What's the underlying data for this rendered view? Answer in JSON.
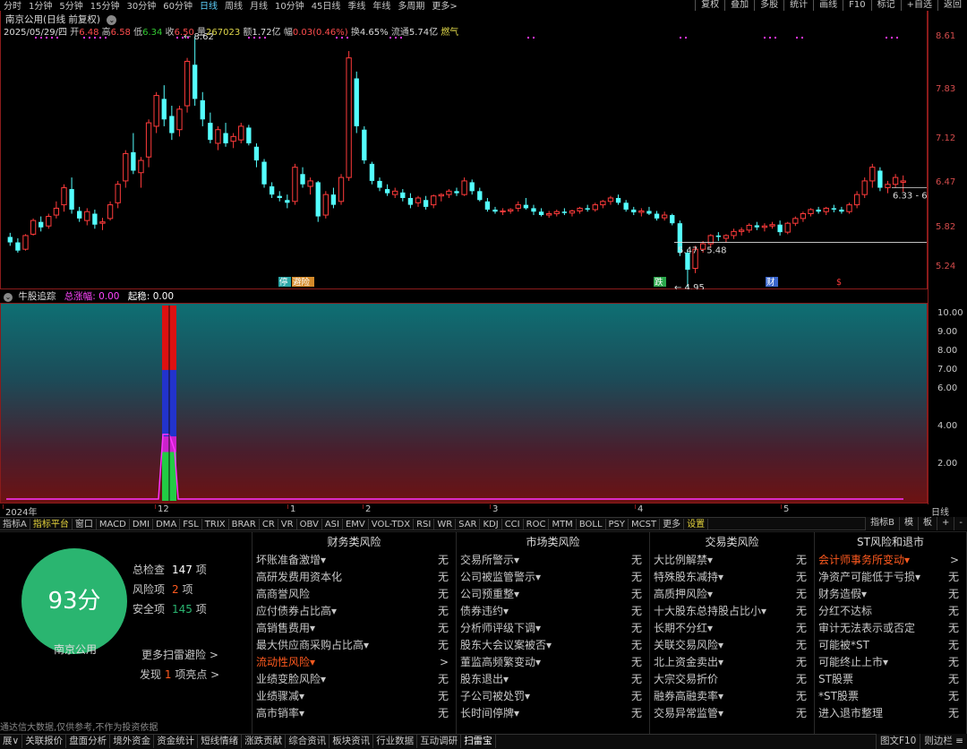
{
  "periods": [
    "分时",
    "1分钟",
    "5分钟",
    "15分钟",
    "30分钟",
    "60分钟",
    "日线",
    "周线",
    "月线",
    "10分钟",
    "45日线",
    "季线",
    "年线",
    "多周期",
    "更多>"
  ],
  "active_period": "日线",
  "toolbar_right": [
    "复权",
    "叠加",
    "多股",
    "统计",
    "画线",
    "F10",
    "标记",
    "+自选",
    "返回"
  ],
  "stock_title": "南京公用(日线 前复权)",
  "quote": {
    "date": "2025/05/29/四",
    "open_label": "开",
    "open": "6.48",
    "high_label": "高",
    "high": "6.58",
    "low_label": "低",
    "low": "6.34",
    "close_label": "收",
    "close": "6.50",
    "vol_label": "量",
    "volume": "267023",
    "amt_label": "额",
    "amount": "1.72亿",
    "chg_label": "幅",
    "change": "0.03(0.46%)",
    "turn_label": "换",
    "turnover": "4.65%",
    "float_label": "流通",
    "float_cap": "5.74亿",
    "concept": "燃气"
  },
  "price_axis": [
    "8.61",
    "7.83",
    "7.12",
    "6.47",
    "5.82",
    "5.24"
  ],
  "chart_annotations": {
    "high": "8.62",
    "low": "4.95",
    "range_low": "5.47 - 5.48",
    "range_right": "6.33 - 6."
  },
  "event_tags": [
    "停",
    "避险",
    "跌",
    "财",
    "$"
  ],
  "sub_indicator": {
    "name": "牛股追踪",
    "field1_label": "总涨幅",
    "field1_value": "0.00",
    "field2_label": "起稳",
    "field2_value": "0.00"
  },
  "sub_axis": [
    "10.00",
    "9.00",
    "8.00",
    "7.00",
    "6.00",
    "4.00",
    "2.00"
  ],
  "date_axis": [
    "2024年",
    "12",
    "1",
    "2",
    "3",
    "4",
    "5"
  ],
  "date_axis_right": "日线",
  "indicator_tabs": [
    "指标A",
    "指标平台",
    "窗口",
    "MACD",
    "DMI",
    "DMA",
    "FSL",
    "TRIX",
    "BRAR",
    "CR",
    "VR",
    "OBV",
    "ASI",
    "EMV",
    "VOL-TDX",
    "RSI",
    "WR",
    "SAR",
    "KDJ",
    "CCI",
    "ROC",
    "MTM",
    "BOLL",
    "PSY",
    "MCST",
    "更多",
    "设置"
  ],
  "indicator_tabs_right": [
    "指标B",
    "模",
    "板",
    "+",
    "-"
  ],
  "risk": {
    "score": "93分",
    "stock_name": "南京公用",
    "total_label": "总检查",
    "total": "147",
    "total_unit": "项",
    "risk_label": "风险项",
    "risk": "2",
    "risk_unit": "项",
    "safe_label": "安全项",
    "safe": "145",
    "safe_unit": "项",
    "more": "更多扫雷避险 >",
    "found_prefix": "发现",
    "found_count": "1",
    "found_suffix": "项亮点 >",
    "watermark": "通达信大数据,仅供参考,不作为投资依据",
    "colors": {
      "score_bg": "#2ab570",
      "highlight": "#ff5a1f"
    }
  },
  "risk_columns": [
    {
      "title": "财务类风险",
      "items": [
        {
          "name": "坏账准备激增▾",
          "status": "无"
        },
        {
          "name": "高研发费用资本化",
          "status": "无"
        },
        {
          "name": "高商誉风险",
          "status": "无"
        },
        {
          "name": "应付债券占比高▾",
          "status": "无"
        },
        {
          "name": "高销售费用▾",
          "status": "无"
        },
        {
          "name": "最大供应商采购占比高▾",
          "status": "无"
        },
        {
          "name": "流动性风险▾",
          "status": ">",
          "hl": true
        },
        {
          "name": "业绩变脸风险▾",
          "status": "无"
        },
        {
          "name": "业绩骤减▾",
          "status": "无"
        },
        {
          "name": "高市销率▾",
          "status": "无"
        }
      ]
    },
    {
      "title": "市场类风险",
      "items": [
        {
          "name": "交易所警示▾",
          "status": "无"
        },
        {
          "name": "公司被监管警示▾",
          "status": "无"
        },
        {
          "name": "公司预重整▾",
          "status": "无"
        },
        {
          "name": "债券违约▾",
          "status": "无"
        },
        {
          "name": "分析师评级下调▾",
          "status": "无"
        },
        {
          "name": "股东大会议案被否▾",
          "status": "无"
        },
        {
          "name": "董监高频繁变动▾",
          "status": "无"
        },
        {
          "name": "股东退出▾",
          "status": "无"
        },
        {
          "name": "子公司被处罚▾",
          "status": "无"
        },
        {
          "name": "长时间停牌▾",
          "status": "无"
        }
      ]
    },
    {
      "title": "交易类风险",
      "items": [
        {
          "name": "大比例解禁▾",
          "status": "无"
        },
        {
          "name": "特殊股东减持▾",
          "status": "无"
        },
        {
          "name": "高质押风险▾",
          "status": "无"
        },
        {
          "name": "十大股东总持股占比小▾",
          "status": "无"
        },
        {
          "name": "长期不分红▾",
          "status": "无"
        },
        {
          "name": "关联交易风险▾",
          "status": "无"
        },
        {
          "name": "北上资金卖出▾",
          "status": "无"
        },
        {
          "name": "大宗交易折价",
          "status": "无"
        },
        {
          "name": "融券高融卖率▾",
          "status": "无"
        },
        {
          "name": "交易异常监管▾",
          "status": "无"
        }
      ]
    },
    {
      "title": "ST风险和退市",
      "items": [
        {
          "name": "会计师事务所变动▾",
          "status": ">",
          "hl": true
        },
        {
          "name": "净资产可能低于亏损▾",
          "status": "无"
        },
        {
          "name": "财务造假▾",
          "status": "无"
        },
        {
          "name": "分红不达标",
          "status": "无"
        },
        {
          "name": "审计无法表示或否定",
          "status": "无"
        },
        {
          "name": "可能被*ST",
          "status": "无"
        },
        {
          "name": "可能终止上市▾",
          "status": "无"
        },
        {
          "name": "ST股票",
          "status": "无"
        },
        {
          "name": "*ST股票",
          "status": "无"
        },
        {
          "name": "进入退市整理",
          "status": "无"
        }
      ]
    }
  ],
  "bottom_tabs": [
    "展∨",
    "关联报价",
    "盘面分析",
    "境外资金",
    "资金统计",
    "短线情绪",
    "涨跌贡献",
    "综合资讯",
    "板块资讯",
    "行业数据",
    "互动调研",
    "扫雷宝"
  ],
  "bottom_active": "扫雷宝",
  "bottom_right": [
    "图文F10",
    "则边栏 ≡"
  ],
  "chart_data": {
    "type": "candlestick",
    "y_axis_ticks": [
      8.61,
      7.83,
      7.12,
      6.47,
      5.82,
      5.24
    ],
    "ohlc": [
      [
        5.68,
        5.74,
        5.55,
        5.6
      ],
      [
        5.6,
        5.66,
        5.45,
        5.48
      ],
      [
        5.5,
        5.72,
        5.48,
        5.7
      ],
      [
        5.72,
        5.95,
        5.7,
        5.92
      ],
      [
        5.9,
        5.98,
        5.76,
        5.82
      ],
      [
        5.84,
        6.02,
        5.8,
        5.98
      ],
      [
        6.0,
        6.2,
        5.95,
        6.1
      ],
      [
        6.15,
        6.45,
        6.05,
        6.4
      ],
      [
        6.38,
        6.55,
        6.02,
        6.08
      ],
      [
        6.06,
        6.12,
        5.9,
        5.95
      ],
      [
        5.92,
        6.1,
        5.85,
        6.05
      ],
      [
        6.02,
        6.08,
        5.8,
        5.86
      ],
      [
        5.88,
        5.96,
        5.78,
        5.9
      ],
      [
        5.95,
        6.2,
        5.92,
        6.15
      ],
      [
        6.18,
        6.5,
        6.1,
        6.45
      ],
      [
        6.5,
        6.95,
        6.4,
        6.9
      ],
      [
        6.92,
        7.2,
        6.6,
        6.65
      ],
      [
        6.62,
        6.85,
        6.4,
        6.8
      ],
      [
        6.85,
        7.4,
        6.7,
        7.35
      ],
      [
        7.3,
        7.8,
        7.2,
        7.75
      ],
      [
        7.7,
        7.9,
        7.3,
        7.4
      ],
      [
        7.45,
        7.6,
        7.1,
        7.2
      ],
      [
        7.25,
        7.6,
        7.15,
        7.55
      ],
      [
        7.6,
        8.3,
        7.5,
        8.25
      ],
      [
        8.2,
        8.62,
        7.6,
        7.7
      ],
      [
        7.68,
        7.8,
        7.3,
        7.4
      ],
      [
        7.35,
        7.5,
        7.05,
        7.1
      ],
      [
        7.05,
        7.3,
        6.95,
        7.25
      ],
      [
        7.2,
        7.35,
        7.0,
        7.05
      ],
      [
        7.08,
        7.2,
        6.98,
        7.15
      ],
      [
        7.1,
        7.35,
        7.05,
        7.3
      ],
      [
        7.28,
        7.32,
        7.02,
        7.05
      ],
      [
        7.0,
        7.05,
        6.7,
        6.8
      ],
      [
        6.78,
        6.82,
        6.4,
        6.45
      ],
      [
        6.42,
        6.48,
        6.25,
        6.3
      ],
      [
        6.28,
        6.35,
        6.2,
        6.25
      ],
      [
        6.22,
        6.3,
        6.1,
        6.18
      ],
      [
        6.2,
        6.75,
        6.15,
        6.7
      ],
      [
        6.6,
        6.7,
        6.4,
        6.45
      ],
      [
        6.42,
        6.55,
        6.3,
        6.5
      ],
      [
        6.48,
        6.5,
        5.9,
        5.98
      ],
      [
        6.0,
        6.35,
        5.95,
        6.3
      ],
      [
        6.3,
        6.4,
        6.1,
        6.15
      ],
      [
        6.2,
        6.6,
        6.15,
        6.55
      ],
      [
        6.55,
        8.4,
        6.5,
        8.3
      ],
      [
        8.0,
        8.1,
        7.2,
        7.3
      ],
      [
        7.25,
        7.3,
        6.75,
        6.8
      ],
      [
        6.75,
        6.78,
        6.45,
        6.5
      ],
      [
        6.5,
        6.55,
        6.35,
        6.4
      ],
      [
        6.38,
        6.45,
        6.28,
        6.32
      ],
      [
        6.3,
        6.4,
        6.25,
        6.35
      ],
      [
        6.33,
        6.38,
        6.2,
        6.25
      ],
      [
        6.25,
        6.32,
        6.1,
        6.15
      ],
      [
        6.18,
        6.28,
        6.12,
        6.25
      ],
      [
        6.22,
        6.28,
        6.08,
        6.12
      ],
      [
        6.15,
        6.3,
        6.1,
        6.28
      ],
      [
        6.28,
        6.32,
        6.2,
        6.3
      ],
      [
        6.3,
        6.38,
        6.25,
        6.35
      ],
      [
        6.35,
        6.4,
        6.28,
        6.32
      ],
      [
        6.3,
        6.55,
        6.28,
        6.5
      ],
      [
        6.48,
        6.52,
        6.3,
        6.35
      ],
      [
        6.35,
        6.4,
        6.2,
        6.22
      ],
      [
        6.2,
        6.25,
        6.05,
        6.08
      ],
      [
        6.08,
        6.12,
        6.02,
        6.05
      ],
      [
        6.05,
        6.1,
        6.0,
        6.06
      ],
      [
        6.06,
        6.1,
        6.02,
        6.08
      ],
      [
        6.1,
        6.2,
        6.05,
        6.15
      ],
      [
        6.15,
        6.25,
        6.08,
        6.1
      ],
      [
        6.1,
        6.15,
        6.0,
        6.05
      ],
      [
        6.05,
        6.1,
        5.98,
        6.0
      ],
      [
        6.0,
        6.06,
        5.96,
        6.02
      ],
      [
        6.02,
        6.08,
        5.98,
        6.05
      ],
      [
        6.05,
        6.1,
        6.0,
        6.03
      ],
      [
        6.03,
        6.08,
        5.98,
        6.06
      ],
      [
        6.06,
        6.12,
        6.02,
        6.1
      ],
      [
        6.1,
        6.15,
        6.05,
        6.08
      ],
      [
        6.08,
        6.18,
        6.05,
        6.15
      ],
      [
        6.15,
        6.22,
        6.1,
        6.2
      ],
      [
        6.2,
        6.28,
        6.15,
        6.25
      ],
      [
        6.25,
        6.3,
        6.15,
        6.18
      ],
      [
        6.18,
        6.22,
        6.05,
        6.08
      ],
      [
        6.08,
        6.12,
        6.0,
        6.04
      ],
      [
        6.04,
        6.1,
        5.98,
        6.06
      ],
      [
        6.06,
        6.12,
        6.0,
        6.02
      ],
      [
        6.02,
        6.06,
        5.92,
        5.95
      ],
      [
        5.96,
        6.05,
        5.92,
        6.0
      ],
      [
        6.0,
        6.02,
        5.85,
        5.88
      ],
      [
        5.88,
        5.92,
        5.4,
        5.45
      ],
      [
        5.45,
        5.5,
        4.95,
        5.2
      ],
      [
        5.22,
        5.55,
        5.15,
        5.5
      ],
      [
        5.5,
        5.62,
        5.45,
        5.58
      ],
      [
        5.58,
        5.72,
        5.52,
        5.7
      ],
      [
        5.7,
        5.75,
        5.62,
        5.68
      ],
      [
        5.66,
        5.72,
        5.6,
        5.7
      ],
      [
        5.7,
        5.8,
        5.65,
        5.76
      ],
      [
        5.76,
        5.82,
        5.7,
        5.78
      ],
      [
        5.78,
        5.88,
        5.74,
        5.85
      ],
      [
        5.85,
        5.9,
        5.78,
        5.82
      ],
      [
        5.82,
        5.88,
        5.76,
        5.84
      ],
      [
        5.84,
        5.9,
        5.8,
        5.86
      ],
      [
        5.86,
        5.92,
        5.7,
        5.75
      ],
      [
        5.75,
        5.9,
        5.72,
        5.88
      ],
      [
        5.88,
        5.98,
        5.84,
        5.95
      ],
      [
        5.95,
        6.05,
        5.9,
        6.02
      ],
      [
        6.02,
        6.1,
        5.98,
        6.08
      ],
      [
        6.08,
        6.12,
        6.02,
        6.05
      ],
      [
        6.05,
        6.12,
        6.0,
        6.1
      ],
      [
        6.1,
        6.15,
        6.04,
        6.08
      ],
      [
        6.08,
        6.12,
        6.02,
        6.05
      ],
      [
        6.05,
        6.18,
        6.02,
        6.15
      ],
      [
        6.15,
        6.35,
        6.1,
        6.3
      ],
      [
        6.3,
        6.55,
        6.25,
        6.5
      ],
      [
        6.5,
        6.75,
        6.4,
        6.7
      ],
      [
        6.65,
        6.7,
        6.35,
        6.4
      ],
      [
        6.4,
        6.5,
        6.32,
        6.45
      ],
      [
        6.45,
        6.6,
        6.4,
        6.55
      ],
      [
        6.48,
        6.58,
        6.34,
        6.5
      ]
    ],
    "sub_axis_ticks": [
      10,
      9,
      8,
      7,
      6,
      4,
      2
    ],
    "sub_bar": {
      "category": "12",
      "segments": [
        {
          "color": "#22cc44",
          "value": 2.5
        },
        {
          "color": "#cc22cc",
          "value": 3.3
        },
        {
          "color": "#2233cc",
          "value": 6.7
        },
        {
          "color": "#dd1111",
          "value": 10
        }
      ]
    }
  }
}
